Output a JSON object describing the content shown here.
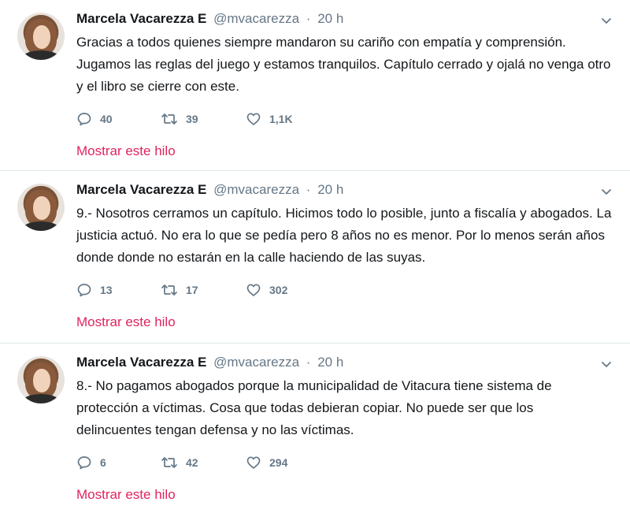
{
  "tweets": [
    {
      "name": "Marcela Vacarezza E",
      "handle": "@mvacarezza",
      "separator": "·",
      "time": "20 h",
      "text": "Gracias a todos quienes siempre mandaron su cariño con empatía y comprensión. Jugamos las reglas del juego y estamos tranquilos. Capítulo cerrado y ojalá no venga otro y el libro se cierre con este.",
      "replies": "40",
      "retweets": "39",
      "likes": "1,1K",
      "thread_link": "Mostrar este hilo"
    },
    {
      "name": "Marcela Vacarezza E",
      "handle": "@mvacarezza",
      "separator": "·",
      "time": "20 h",
      "text": "9.- Nosotros cerramos un capítulo. Hicimos todo lo posible, junto a fiscalía y abogados. La justicia actuó. No era lo que se pedía pero 8 años no es menor. Por lo menos serán años donde donde no estarán en la calle haciendo de las suyas.",
      "replies": "13",
      "retweets": "17",
      "likes": "302",
      "thread_link": "Mostrar este hilo"
    },
    {
      "name": "Marcela Vacarezza E",
      "handle": "@mvacarezza",
      "separator": "·",
      "time": "20 h",
      "text": "8.- No pagamos abogados porque la municipalidad de Vitacura tiene sistema de protección a víctimas. Cosa que todas debieran copiar. No puede ser que los delincuentes tengan defensa y no las víctimas.",
      "replies": "6",
      "retweets": "42",
      "likes": "294",
      "thread_link": "Mostrar este hilo"
    }
  ],
  "colors": {
    "text": "#14171a",
    "muted": "#657786",
    "thread_link": "#e0245e",
    "divider": "#e1e8ed"
  },
  "icons": {
    "reply": "reply-icon",
    "retweet": "retweet-icon",
    "like": "heart-icon",
    "caret": "chevron-down-icon"
  }
}
